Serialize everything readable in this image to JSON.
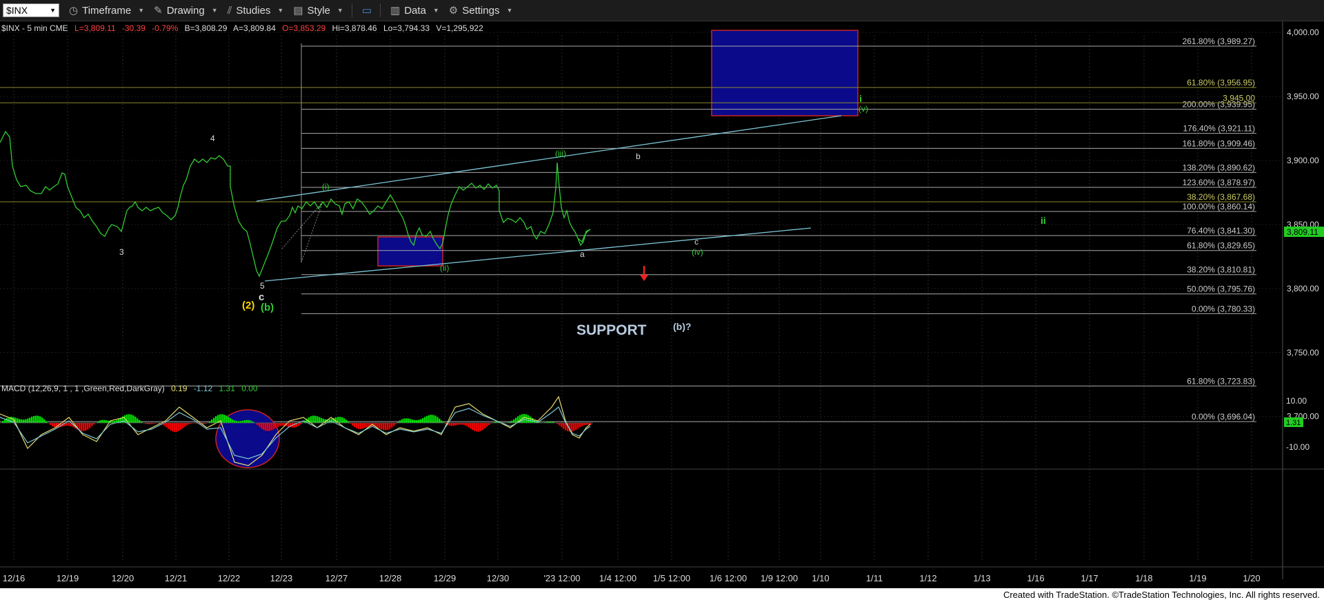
{
  "toolbar": {
    "symbol": "$INX",
    "items": [
      "Timeframe",
      "Drawing",
      "Studies",
      "Style",
      "Data",
      "Settings"
    ]
  },
  "header": {
    "prefix": "$INX - 5 min  CME",
    "low": "L=3,809.11",
    "change": "-30.39",
    "change_pct": "-0.79%",
    "bid": "B=3,808.29",
    "ask": "A=3,809.84",
    "open": "O=3,853.29",
    "hi": "Hi=3,878.46",
    "lo": "Lo=3,794.33",
    "vol": "V=1,295,922"
  },
  "colors": {
    "price_line": "#33cc33",
    "macd_green": "#00dd00",
    "macd_red": "#ee0000",
    "box_fill": "#0a0a8a",
    "box_border": "#cc2222",
    "trendline": "#7ec8d8",
    "last_price_bg": "#22cc22"
  },
  "chart_data": {
    "type": "line",
    "title": "$INX - 5 min",
    "price_axis": {
      "ticks": [
        "4,000.00",
        "3,950.00",
        "3,900.00",
        "3,850.00",
        "3,800.00",
        "3,750.00",
        "3,700.00"
      ],
      "ylim": [
        3650,
        4010
      ]
    },
    "last_price": "3,809.11",
    "date_axis": [
      "12/16",
      "12/19",
      "12/20",
      "12/21",
      "12/22",
      "12/23",
      "12/27",
      "12/28",
      "12/29",
      "12/30",
      "'23 12:00",
      "1/4 12:00",
      "1/5 12:00",
      "1/6 12:00",
      "1/9 12:00",
      "1/10",
      "1/11",
      "1/12",
      "1/13",
      "1/16",
      "1/17",
      "1/18",
      "1/19",
      "1/20"
    ],
    "fib_levels_upper": [
      {
        "label": "261.80% (3,989.27)",
        "value": 3989.27
      },
      {
        "label": "200.00% (3,939.95)",
        "value": 3939.95
      },
      {
        "label": "176.40% (3,921.11)",
        "value": 3921.11
      },
      {
        "label": "161.80% (3,909.46)",
        "value": 3909.46
      },
      {
        "label": "138.20% (3,890.62)",
        "value": 3890.62
      },
      {
        "label": "123.60% (3,878.97)",
        "value": 3878.97
      },
      {
        "label": "100.00% (3,860.14)",
        "value": 3860.14
      },
      {
        "label": "76.40% (3,841.30)",
        "value": 3841.3
      },
      {
        "label": "61.80% (3,829.65)",
        "value": 3829.65
      },
      {
        "label": "38.20% (3,810.81)",
        "value": 3810.81
      },
      {
        "label": "50.00% (3,795.76)",
        "value": 3795.76
      },
      {
        "label": "0.00% (3,780.33)",
        "value": 3780.33
      }
    ],
    "fib_levels_lower": [
      {
        "label": "61.80% (3,723.83)",
        "value": 3723.83
      },
      {
        "label": "0.00% (3,696.04)",
        "value": 3696.04
      }
    ],
    "extra_levels": [
      {
        "label": "61.80% (3,956.95)",
        "value": 3956.95
      },
      {
        "label": "3,945.00",
        "value": 3945.0
      },
      {
        "label": "38.20% (3,867.68)",
        "value": 3867.68
      }
    ],
    "annotations": {
      "support": "SUPPORT",
      "b_question": "(b)?",
      "wave_labels": [
        "4",
        "3",
        "5",
        "c",
        "(2)",
        "(b)",
        "(i)",
        "(ii)",
        "(iii)",
        "b",
        "a",
        "c",
        "(iv)",
        "i",
        "(v)",
        "ii"
      ]
    },
    "macd": {
      "label": "MACD (12,26,9, 1 , 1 ,Green,Red,DarkGray)",
      "values": [
        "0.19",
        "-1.12",
        "1.31",
        "0.00"
      ],
      "axis": [
        "10.00",
        "-10.00"
      ],
      "last": "1.31"
    }
  },
  "footer": {
    "credit": "Created with TradeStation. ©TradeStation Technologies, Inc. All rights reserved."
  }
}
